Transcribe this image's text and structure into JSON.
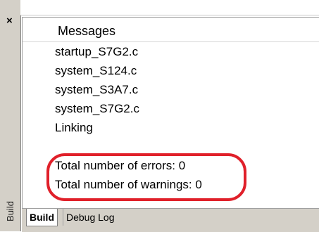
{
  "panel": {
    "vertical_label": "Build",
    "close_glyph": "×"
  },
  "messages": {
    "header": "Messages",
    "lines": [
      "startup_S7G2.c",
      "system_S124.c",
      "system_S3A7.c",
      "system_S7G2.c",
      "Linking",
      "Total number of errors: 0",
      "Total number of warnings: 0"
    ]
  },
  "tabs": [
    "Build",
    "Debug Log"
  ],
  "colors": {
    "highlight": "#e0202a",
    "chrome": "#d4d0c8"
  }
}
